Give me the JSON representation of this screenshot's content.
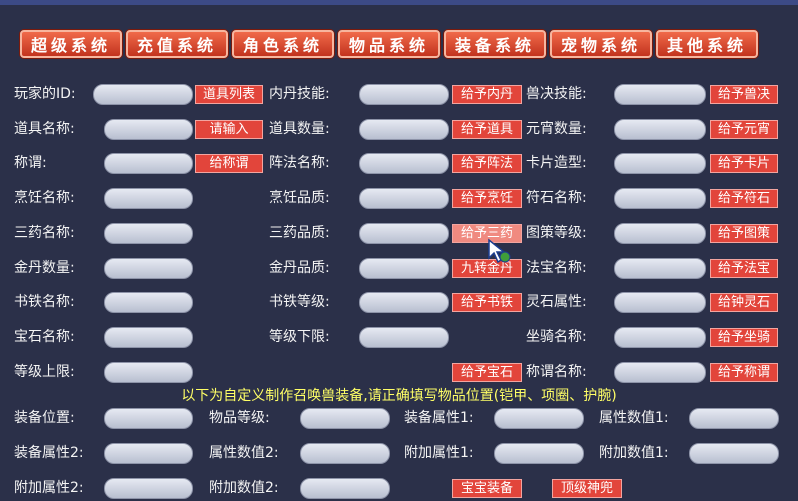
{
  "tabs": [
    "超级系统",
    "充值系统",
    "角色系统",
    "物品系统",
    "装备系统",
    "宠物系统",
    "其他系统"
  ],
  "rows": [
    {
      "l1": "玩家的ID:",
      "b1": "道具列表",
      "l2": "内丹技能:",
      "b2": "给予内丹",
      "l3": "兽决技能:",
      "b3": "给予兽决"
    },
    {
      "l1": "道具名称:",
      "b1": "请输入",
      "l2": "道具数量:",
      "b2": "给予道具",
      "l3": "元宵数量:",
      "b3": "给予元宵"
    },
    {
      "l1": "称谓:",
      "b1": "给称谓",
      "l2": "阵法名称:",
      "b2": "给予阵法",
      "l3": "卡片造型:",
      "b3": "给予卡片"
    },
    {
      "l1": "烹饪名称:",
      "b1": "",
      "l2": "烹饪品质:",
      "b2": "给予烹饪",
      "l3": "符石名称:",
      "b3": "给予符石"
    },
    {
      "l1": "三药名称:",
      "b1": "",
      "l2": "三药品质:",
      "b2": "给予三药",
      "l3": "图策等级:",
      "b3": "给予图策"
    },
    {
      "l1": "金丹数量:",
      "b1": "",
      "l2": "金丹品质:",
      "b2": "九转金丹",
      "l3": "法宝名称:",
      "b3": "给予法宝"
    },
    {
      "l1": "书铁名称:",
      "b1": "",
      "l2": "书铁等级:",
      "b2": "给予书铁",
      "l3": "灵石属性:",
      "b3": "给钟灵石"
    },
    {
      "l1": "宝石名称:",
      "b1": "",
      "l2": "等级下限:",
      "b2": "",
      "l3": "坐骑名称:",
      "b3": "给予坐骑"
    },
    {
      "l1": "等级上限:",
      "b1": "",
      "l2": "",
      "b2": "给予宝石",
      "l3": "称谓名称:",
      "b3": "给予称谓"
    }
  ],
  "notice": "以下为自定义制作召唤兽装备,请正确填写物品位置(铠甲、项圈、护腕)",
  "equip_rows": [
    [
      "装备位置:",
      "物品等级:",
      "装备属性1:",
      "属性数值1:"
    ],
    [
      "装备属性2:",
      "属性数值2:",
      "附加属性1:",
      "附加数值1:"
    ],
    [
      "附加属性2:",
      "附加数值2:"
    ]
  ],
  "bottom_buttons": [
    "宝宝装备",
    "顶级神兜"
  ]
}
